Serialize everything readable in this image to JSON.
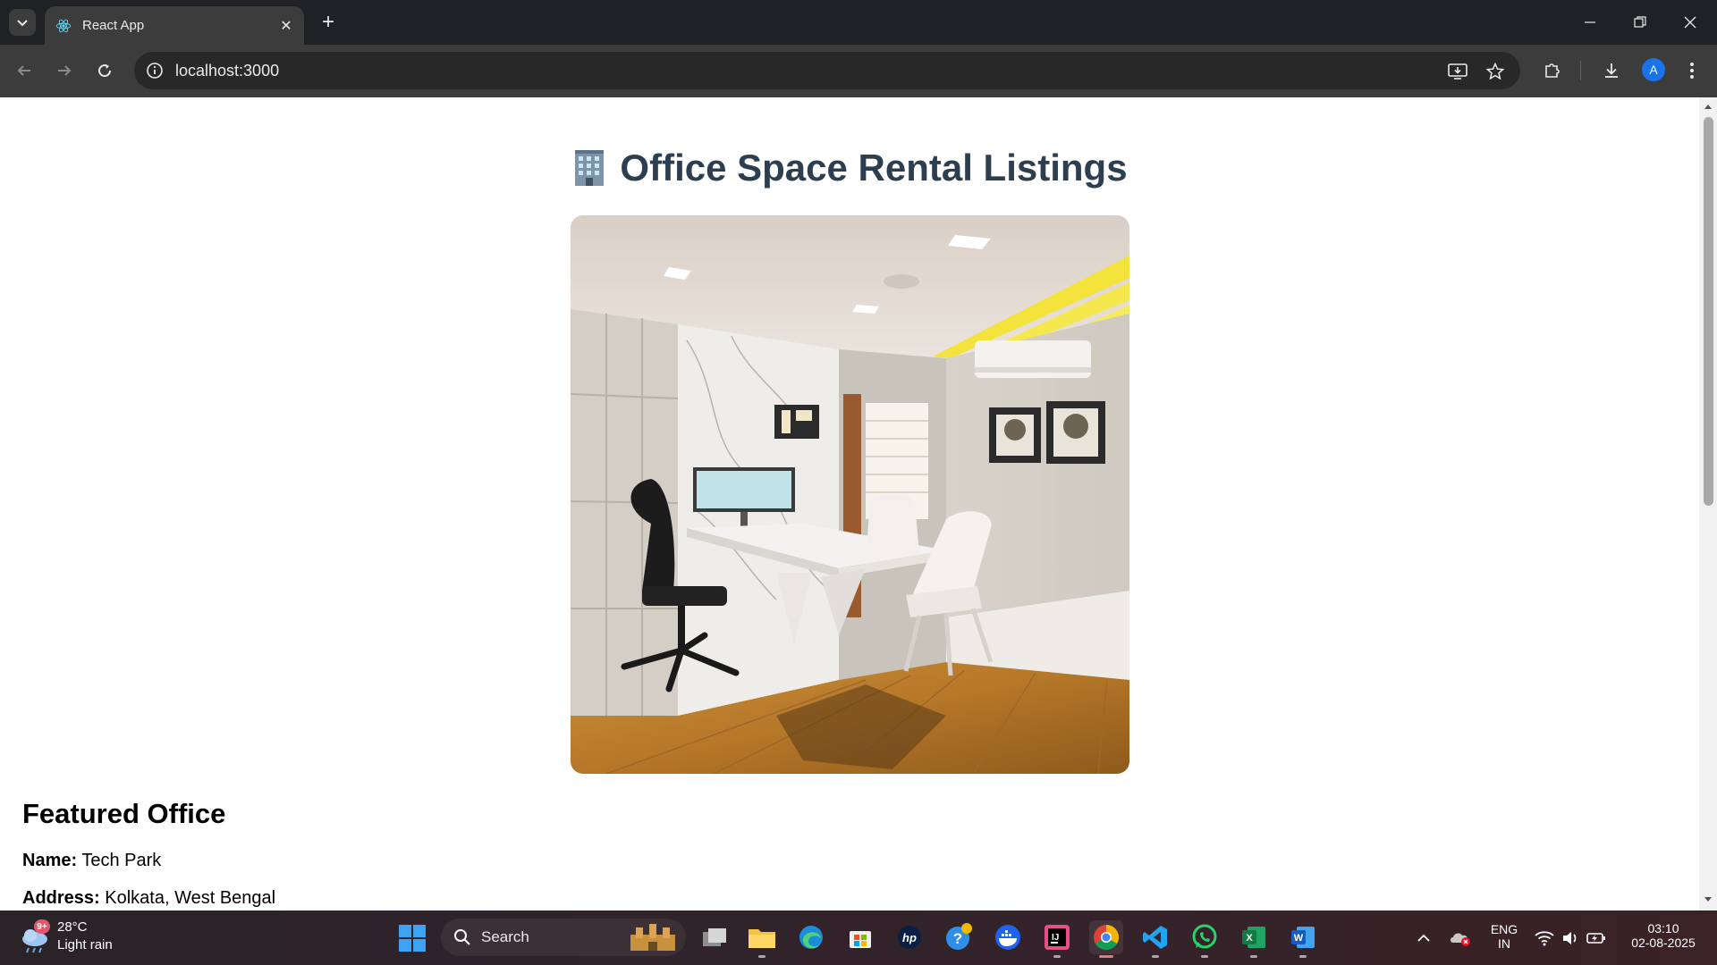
{
  "browser": {
    "tab_title": "React App",
    "url": "localhost:3000",
    "profile_initial": "A"
  },
  "page": {
    "title": "Office Space Rental Listings",
    "title_icon": "office-building-emoji",
    "image_alt": "Modern office cabin with white desk, black chair and wooden floor",
    "featured": {
      "heading": "Featured Office",
      "name_label": "Name:",
      "name_value": "Tech Park",
      "address_label": "Address:",
      "address_value": "Kolkata, West Bengal"
    }
  },
  "taskbar": {
    "weather_badge": "9+",
    "temperature": "28°C",
    "condition": "Light rain",
    "search_label": "Search",
    "language_top": "ENG",
    "language_bottom": "IN",
    "time": "03:10",
    "date": "02-08-2025",
    "apps": [
      "task-view",
      "file-explorer",
      "edge",
      "microsoft-store",
      "hp",
      "get-help",
      "docker",
      "intellij",
      "chrome",
      "vscode",
      "whatsapp",
      "excel",
      "word"
    ]
  }
}
